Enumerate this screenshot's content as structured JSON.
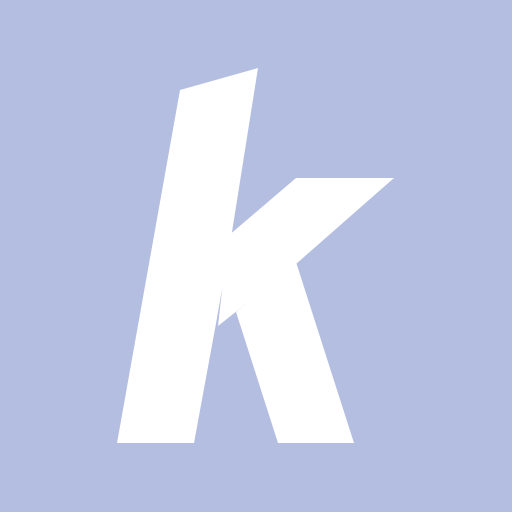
{
  "app_icon": {
    "background_color": "#b3bee1",
    "glyph_color": "#ffffff",
    "glyph_icon": "letter-k-logo-icon",
    "logo_letter": "k"
  }
}
